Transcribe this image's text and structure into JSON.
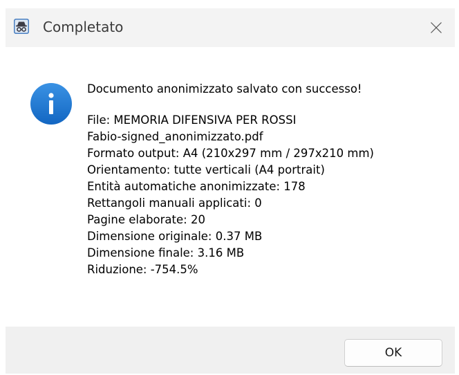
{
  "window": {
    "title": "Completato",
    "app_icon": "incognito-app-icon",
    "close_icon": "close-icon"
  },
  "message": {
    "icon": "info-icon",
    "headline": "Documento anonimizzato salvato con successo!",
    "details": [
      "File: MEMORIA DIFENSIVA PER ROSSI",
      "Fabio-signed_anonimizzato.pdf",
      "Formato output: A4 (210x297 mm / 297x210 mm)",
      "Orientamento: tutte verticali (A4 portrait)",
      "Entità automatiche anonimizzate: 178",
      "Rettangoli manuali applicati: 0",
      "Pagine elaborate: 20",
      "Dimensione originale: 0.37 MB",
      "Dimensione finale: 3.16 MB",
      "Riduzione: -754.5%"
    ]
  },
  "footer": {
    "ok_label": "OK"
  },
  "colors": {
    "info_accent": "#1a73d0",
    "titlebar_bg": "#f3f3f3",
    "footer_bg": "#f0f0f0"
  }
}
